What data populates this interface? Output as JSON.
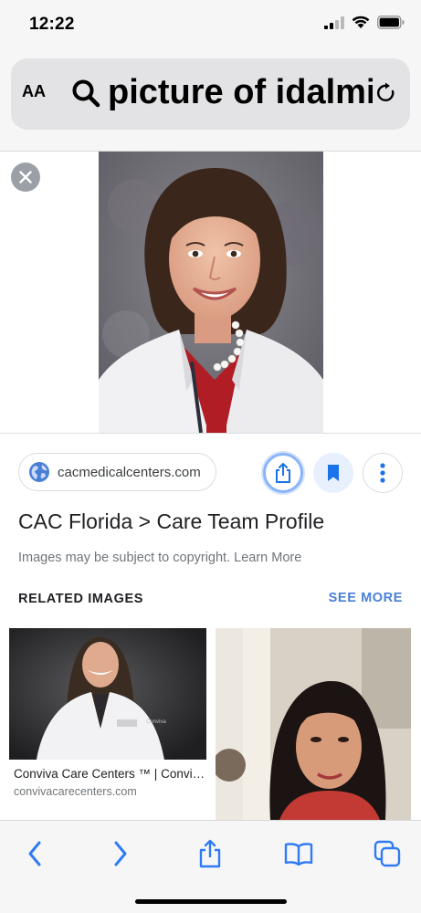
{
  "status_bar": {
    "time": "12:22",
    "icons": [
      "signal-icon",
      "wifi-icon",
      "battery-icon"
    ]
  },
  "address_bar": {
    "text_size_label": "AA",
    "search_icon": "search-icon",
    "query": "picture of idalmis",
    "reload_icon": "reload-icon"
  },
  "viewer": {
    "close_icon": "close-icon",
    "image_alt": "portrait photo"
  },
  "result": {
    "source": "cacmedicalcenters.com",
    "actions": [
      "share-icon",
      "bookmark-icon",
      "more-vert-icon"
    ],
    "title": "CAC Florida > Care Team Profile",
    "copyright_note": "Images may be subject to copyright. Learn More"
  },
  "related": {
    "heading": "RELATED IMAGES",
    "see_more": "SEE MORE",
    "items": [
      {
        "title": "Conviva Care Centers ™ | Conviva Care Centers",
        "site": "convivacarecenters.com"
      },
      {
        "title": "",
        "site": ""
      }
    ]
  },
  "toolbar": {
    "items": [
      "back-icon",
      "forward-icon",
      "share-icon",
      "bookmarks-icon",
      "tabs-icon"
    ]
  },
  "colors": {
    "accent": "#1a73e8",
    "see_more": "#4a7fd6",
    "ios_blue": "#2f7bf5"
  }
}
